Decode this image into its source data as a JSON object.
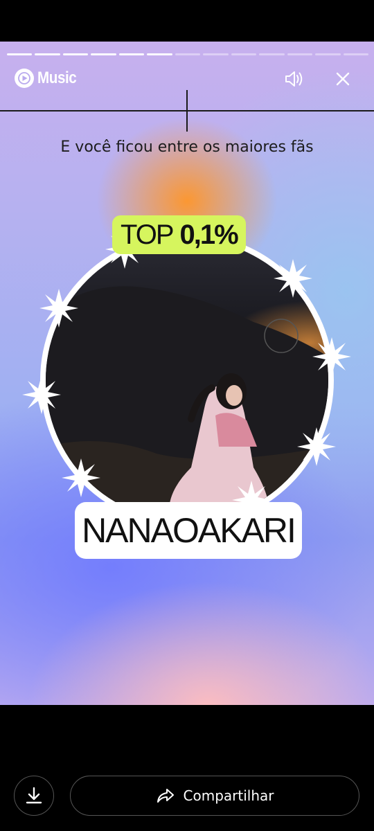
{
  "story": {
    "progress_total": 13,
    "progress_completed": 6,
    "brand": "Music",
    "headline": "E você ficou entre os maiores fãs",
    "top_label": "TOP",
    "top_value": "0,1%",
    "artist": "NANAOAKARI",
    "colors": {
      "badge_green": "#d6f55e",
      "accent_red": "#ff0033"
    }
  },
  "icons": {
    "logo": "youtube-music-icon",
    "sound": "speaker-icon",
    "close": "close-icon",
    "download": "download-icon",
    "share": "share-icon"
  },
  "actions": {
    "share_label": "Compartilhar"
  }
}
